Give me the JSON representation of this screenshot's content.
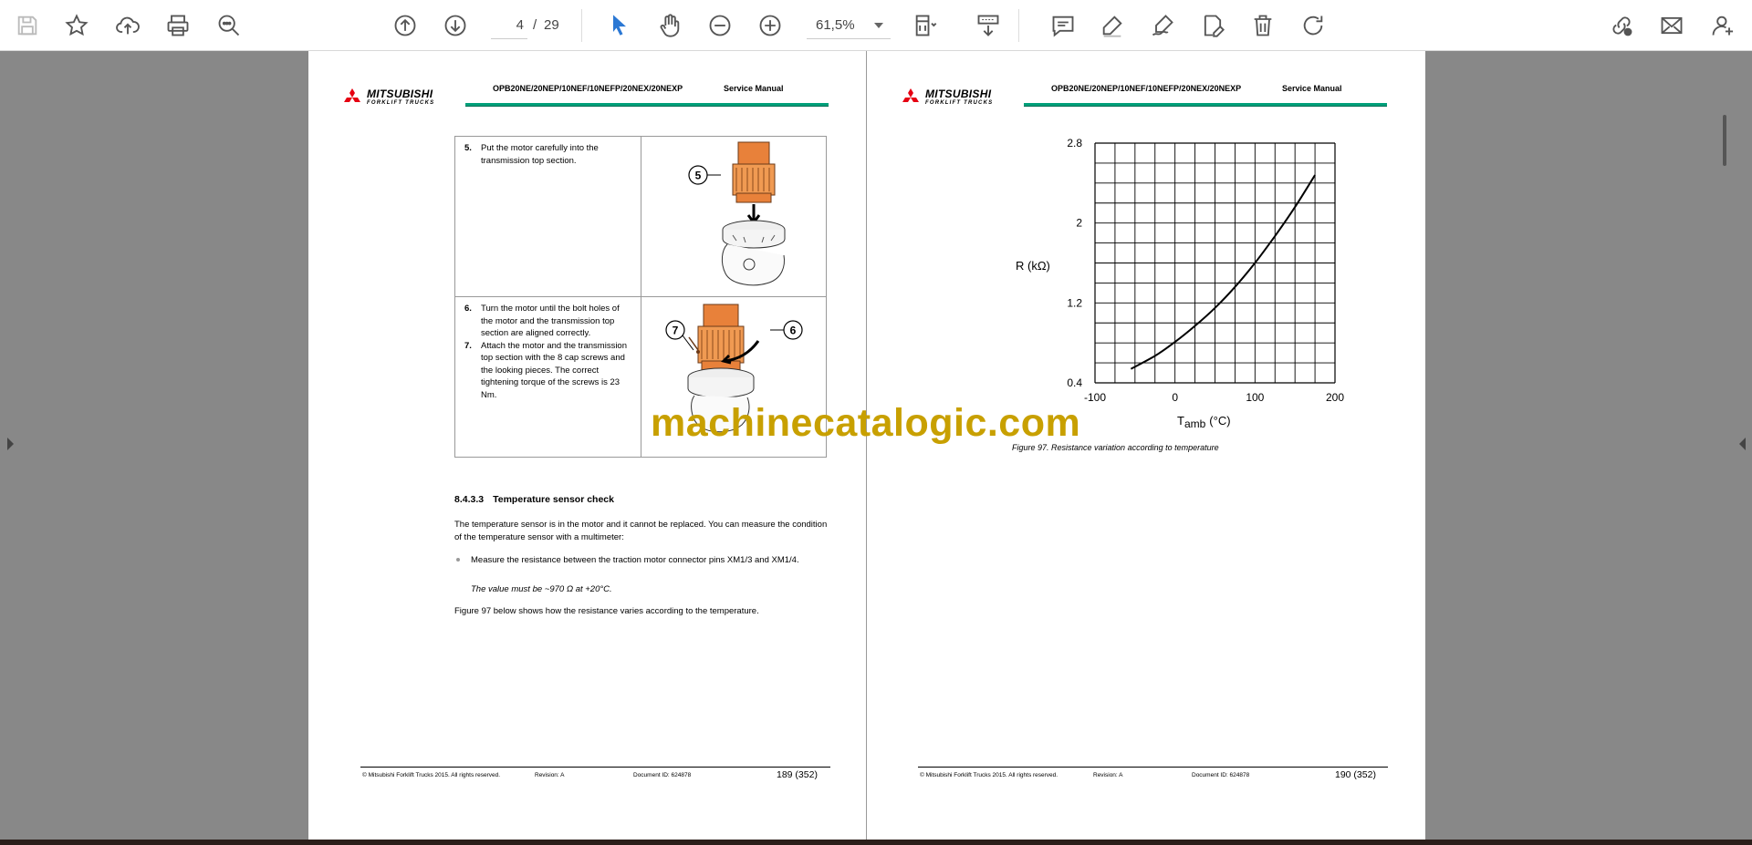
{
  "toolbar": {
    "page_current": "4",
    "page_separator": "/",
    "page_total": "29",
    "zoom": "61,5%"
  },
  "document": {
    "brand": "MITSUBISHI",
    "brand_sub": "FORKLIFT TRUCKS",
    "model": "OPB20NE/20NEP/10NEF/10NEFP/20NEX/20NEXP",
    "manual": "Service Manual",
    "footer_copyright": "© Mitsubishi Forklift Trucks 2015. All rights reserved.",
    "footer_revision": "Revision: A",
    "footer_docid": "Document ID: 624878"
  },
  "page1": {
    "steps": [
      {
        "num": "5.",
        "text": "Put the motor carefully into the transmission top section."
      },
      {
        "num": "6.",
        "text": "Turn the motor until the bolt holes of the motor and the transmission top section are aligned correctly."
      },
      {
        "num": "7.",
        "text": "Attach the motor and the transmission top section with the 8 cap screws and the looking pieces. The correct tightening torque of the screws is 23 Nm."
      }
    ],
    "callouts": [
      "5",
      "7",
      "6"
    ],
    "section_number": "8.4.3.3",
    "section_title": "Temperature sensor check",
    "para1": "The temperature sensor is in the motor and it cannot be replaced. You can measure the condition of the temperature sensor with a multimeter:",
    "bullet": "Measure the resistance between the traction motor connector pins XM1/3 and XM1/4.",
    "note": "The value must be ~970 Ω at +20°C.",
    "para2": "Figure 97 below shows how the resistance varies according to the temperature.",
    "page_number": "189 (352)"
  },
  "page2": {
    "caption": "Figure 97. Resistance variation according to temperature",
    "page_number": "190 (352)"
  },
  "chart_data": {
    "type": "line",
    "xlabel_main": "T",
    "xlabel_sub": "amb",
    "xlabel_unit": "(°C)",
    "ylabel": "R (kΩ)",
    "xlim": [
      -100,
      200
    ],
    "ylim": [
      0.4,
      2.8
    ],
    "xticks": [
      "-100",
      "0",
      "100",
      "200"
    ],
    "yticks": [
      "0.4",
      "1.2",
      "2",
      "2.8"
    ],
    "grid": true,
    "x": [
      -55,
      -25,
      0,
      25,
      50,
      75,
      100,
      125,
      150,
      175
    ],
    "y": [
      0.54,
      0.67,
      0.81,
      0.97,
      1.15,
      1.36,
      1.6,
      1.87,
      2.16,
      2.48
    ]
  },
  "watermark": "machinecatalogic.com"
}
